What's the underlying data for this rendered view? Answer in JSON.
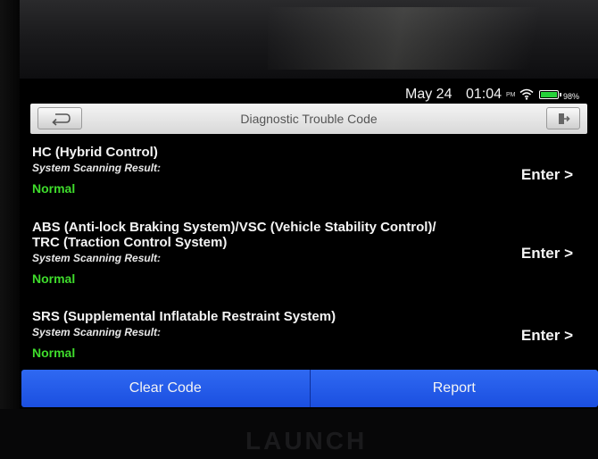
{
  "status_bar": {
    "date": "May 24",
    "time": "01:04",
    "ampm": "PM",
    "battery_percent": "98%",
    "icons": [
      "wifi-icon",
      "battery-icon"
    ],
    "battery_level": 0.98
  },
  "header": {
    "title": "Diagnostic Trouble Code",
    "back_icon": "back-arrow-icon",
    "exit_icon": "exit-icon"
  },
  "systems": [
    {
      "name": "HC (Hybrid Control)",
      "label": "System Scanning Result:",
      "result": "Normal",
      "action": "Enter >"
    },
    {
      "name": "ABS (Anti-lock Braking System)/VSC (Vehicle Stability Control)/ TRC (Traction Control System)",
      "label": "System Scanning Result:",
      "result": "Normal",
      "action": "Enter >"
    },
    {
      "name": "SRS (Supplemental Inflatable Restraint System)",
      "label": "System Scanning Result:",
      "result": "Normal",
      "action": "Enter >"
    }
  ],
  "footer": {
    "clear_label": "Clear Code",
    "report_label": "Report"
  },
  "device": {
    "brand": "LAUNCH"
  },
  "colors": {
    "accent_blue": "#2a62ee",
    "normal_green": "#3fdc2c",
    "title_bar": "#e6e6e6"
  }
}
